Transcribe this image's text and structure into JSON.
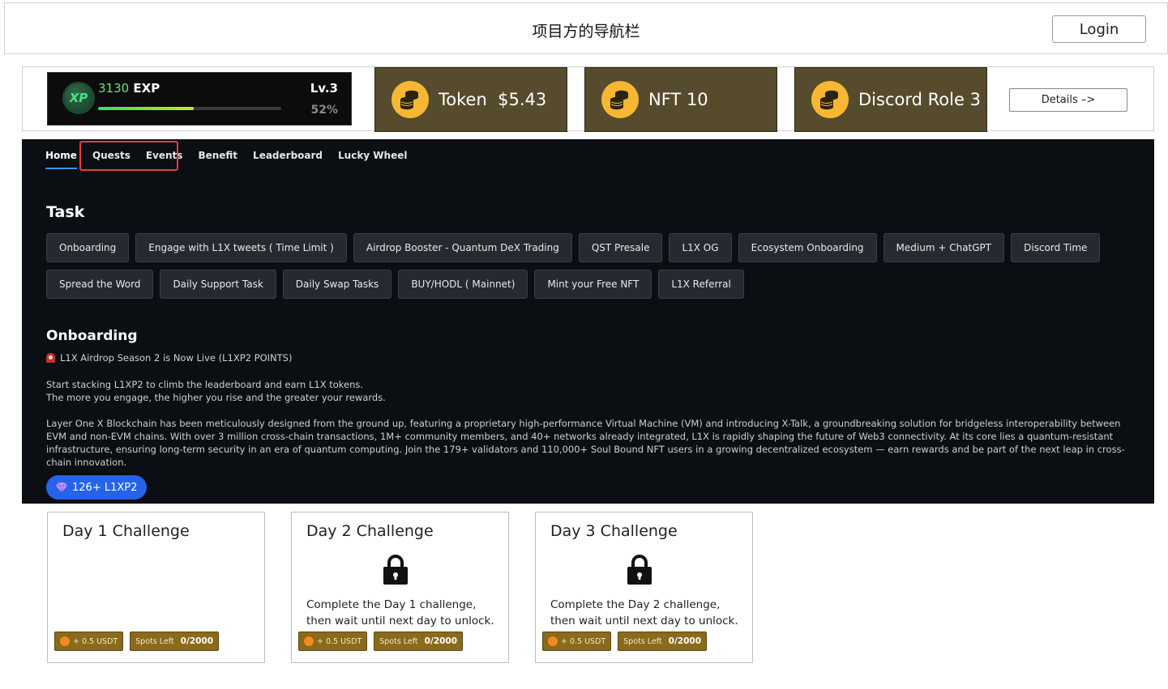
{
  "topbar": {
    "title": "项目方的导航栏",
    "login_label": "Login"
  },
  "stats": {
    "exp": {
      "badge": "XP",
      "value": "3130",
      "unit": "EXP",
      "level": "Lv.3",
      "percent_label": "52%",
      "progress": 0.52
    },
    "cards": [
      {
        "label": "Token",
        "value": "$5.43",
        "icon": "coins-icon"
      },
      {
        "label": "NFT",
        "value": "10",
        "icon": "coins-icon"
      },
      {
        "label": "Discord Role",
        "value": "3",
        "icon": "coins-icon"
      }
    ],
    "details_label": "Details –>"
  },
  "nav": {
    "items": [
      "Home",
      "Quests",
      "Events",
      "Benefit",
      "Leaderboard",
      "Lucky Wheel"
    ],
    "active": "Home",
    "highlighted": [
      "Quests",
      "Events"
    ]
  },
  "task": {
    "title": "Task",
    "chips": [
      "Onboarding",
      "Engage with L1X tweets ( Time Limit )",
      "Airdrop Booster - Quantum DeX Trading",
      "QST Presale",
      "L1X OG",
      "Ecosystem Onboarding",
      "Medium + ChatGPT",
      "Discord Time",
      "Spread the Word",
      "Daily Support Task",
      "Daily Swap Tasks",
      "BUY/HODL ( Mainnet)",
      "Mint your Free NFT",
      "L1X Referral"
    ]
  },
  "onboarding": {
    "title": "Onboarding",
    "season": "L1X Airdrop Season 2 is Now Live (L1XP2 POINTS)",
    "para1_line1": "Start stacking L1XP2 to climb the leaderboard and earn L1X tokens.",
    "para1_line2": "The more you engage, the higher you rise and the greater your rewards.",
    "para2": "Layer One X Blockchain has been meticulously designed from the ground up, featuring a proprietary high-performance Virtual Machine (VM) and introducing X-Talk, a groundbreaking solution for bridgeless interoperability between EVM and non-EVM chains. With over 3 million cross-chain transactions, 1M+ community members, and 40+ networks already integrated, L1X is rapidly shaping the future of Web3 connectivity. At its core lies a quantum-resistant infrastructure, ensuring long-term security in an era of quantum computing. Join the 179+ validators and 110,000+ Soul Bound NFT users in a growing decentralized ecosystem — earn rewards and be part of the next leap in cross-chain innovation.",
    "points_label": "126+ L1XP2"
  },
  "challenges": [
    {
      "title": "Day 1 Challenge",
      "locked": false,
      "desc": "",
      "reward": "+ 0.5 USDT",
      "spots_label": "Spots Left",
      "spots": "0/2000"
    },
    {
      "title": "Day 2 Challenge",
      "locked": true,
      "desc": "Complete the Day 1 challenge, then wait until next day to unlock.",
      "reward": "+ 0.5 USDT",
      "spots_label": "Spots Left",
      "spots": "0/2000"
    },
    {
      "title": "Day 3 Challenge",
      "locked": true,
      "desc": "Complete the Day 2 challenge, then wait until next day to unlock.",
      "reward": "+ 0.5 USDT",
      "spots_label": "Spots Left",
      "spots": "0/2000"
    }
  ],
  "colors": {
    "panel_bg": "#0b0e13",
    "stat_card_bg": "#564b2c",
    "coin": "#f7b733",
    "accent_blue": "#2563ea",
    "highlight_red": "#e0403f",
    "tag_bg": "#8a6a1c"
  }
}
